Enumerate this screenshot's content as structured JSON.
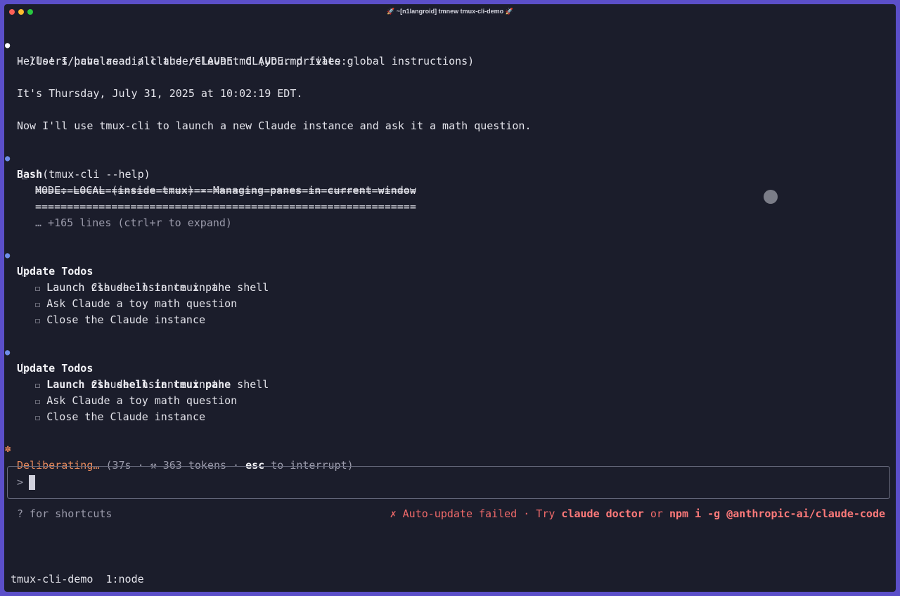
{
  "window": {
    "title": "🚀 ~[n1langroid] tmnew tmux-cli-demo 🚀"
  },
  "conversation": {
    "greeting": "Hello! I have read all the relevant CLAUDE.md files:",
    "file_path": "- /Users/pchalasani/.claude/CLAUDE.md (your private global instructions)",
    "date_line": "It's Thursday, July 31, 2025 at 10:02:19 EDT.",
    "plan_line": "Now I'll use tmux-cli to launch a new Claude instance and ask it a math question."
  },
  "bash_tool": {
    "name": "Bash",
    "args": "(tmux-cli --help)",
    "separator": "============================================================",
    "mode_line": "MODE: LOCAL (inside tmux) - Managing panes in current window",
    "expand_hint": "… +165 lines (ctrl+r to expand)"
  },
  "todos_1": {
    "title": "Update Todos",
    "items": [
      "Launch zsh shell in tmux pane",
      "Launch Claude instance in the shell",
      "Ask Claude a toy math question",
      "Close the Claude instance"
    ]
  },
  "todos_2": {
    "title": "Update Todos",
    "items": [
      "Launch zsh shell in tmux pane",
      "Launch Claude instance in the shell",
      "Ask Claude a toy math question",
      "Close the Claude instance"
    ]
  },
  "tree_glyph": "⎿",
  "checkbox_glyph": "☐",
  "status_line": {
    "spinner": "✽",
    "label": "Deliberating…",
    "time": "(37s · ",
    "hammer": "⚒",
    "tokens": " 363 tokens · ",
    "key": "esc",
    "tail": " to interrupt)"
  },
  "input": {
    "prompt": ">"
  },
  "footer": {
    "shortcuts": "? for shortcuts",
    "error_prefix": "✗ Auto-update failed · Try ",
    "cmd1": "claude doctor",
    "or": " or ",
    "cmd2": "npm i -g @anthropic-ai/claude-code"
  },
  "tmux": {
    "session": "tmux-cli-demo",
    "window": "1:node"
  },
  "colors": {
    "bullet_blue": "#6f8de8",
    "accent_orange": "#e88a5c",
    "error_red": "#f06a6a",
    "background": "#1b1d2b",
    "border": "#5b4fc9"
  }
}
